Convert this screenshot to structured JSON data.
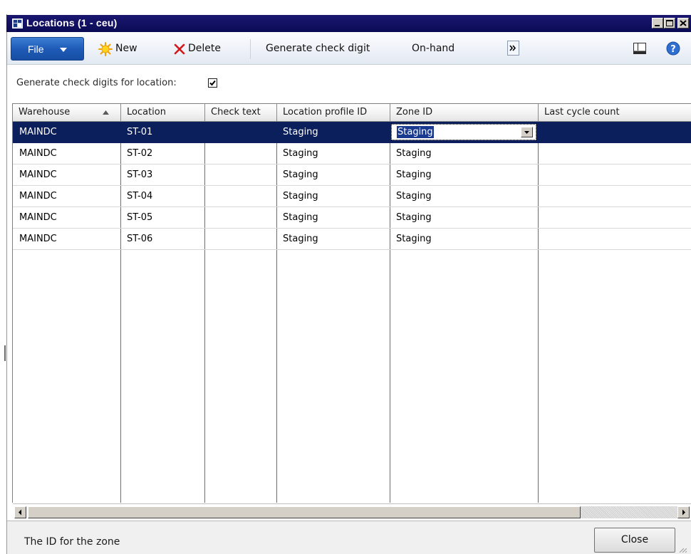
{
  "window": {
    "title": "Locations (1 - ceu)"
  },
  "toolbar": {
    "file_label": "File",
    "new_label": "New",
    "delete_label": "Delete",
    "generate_label": "Generate check digit",
    "onhand_label": "On-hand",
    "overflow_label": "»"
  },
  "options": {
    "check_digit_label": "Generate check digits for location:",
    "check_digit_checked": true
  },
  "grid": {
    "columns": [
      "Warehouse",
      "Location",
      "Check text",
      "Location profile ID",
      "Zone ID",
      "Last cycle count"
    ],
    "sort_column": "Warehouse",
    "sort_direction": "ascending",
    "rows": [
      [
        "MAINDC",
        "ST-01",
        "",
        "Staging",
        "Staging",
        ""
      ],
      [
        "MAINDC",
        "ST-02",
        "",
        "Staging",
        "Staging",
        ""
      ],
      [
        "MAINDC",
        "ST-03",
        "",
        "Staging",
        "Staging",
        ""
      ],
      [
        "MAINDC",
        "ST-04",
        "",
        "Staging",
        "Staging",
        ""
      ],
      [
        "MAINDC",
        "ST-05",
        "",
        "Staging",
        "Staging",
        ""
      ],
      [
        "MAINDC",
        "ST-06",
        "",
        "Staging",
        "Staging",
        ""
      ]
    ],
    "selected_row": 0,
    "editing_value": "Staging"
  },
  "status": {
    "help_text": "The ID for the zone",
    "close_label": "Close"
  },
  "colors": {
    "title_bar": "#0a0b55",
    "selection": "#0b1f5c",
    "file_button": "#1e5bb8"
  }
}
